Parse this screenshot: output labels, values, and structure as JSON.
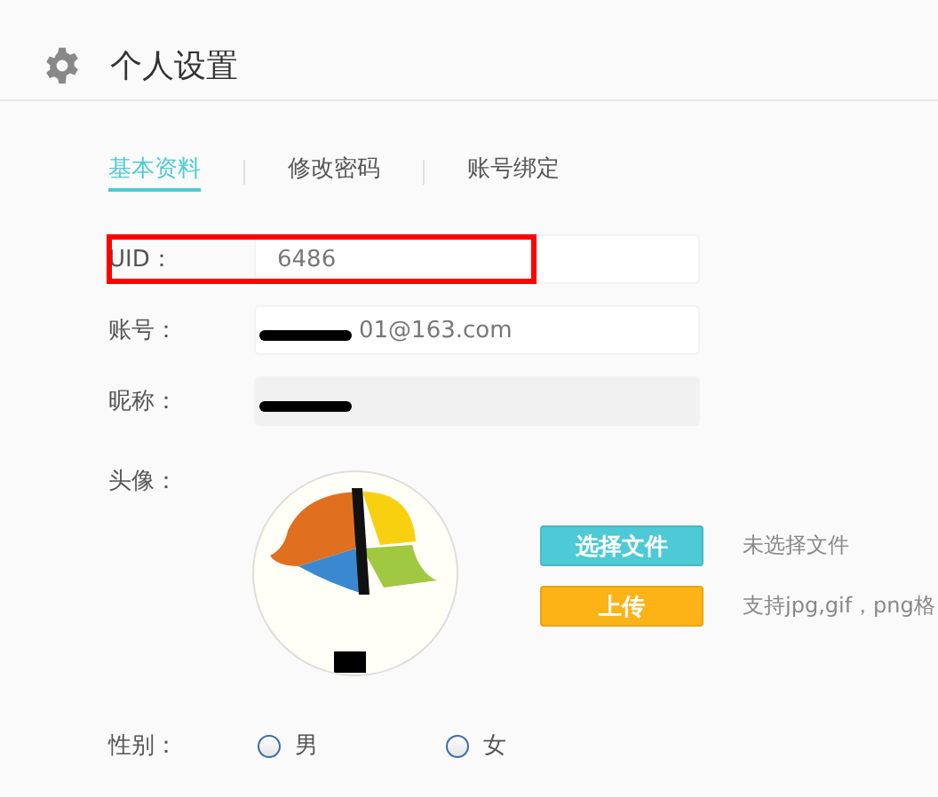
{
  "header": {
    "title": "个人设置"
  },
  "tabs": [
    {
      "label": "基本资料",
      "selected": true
    },
    {
      "label": "修改密码",
      "selected": false
    },
    {
      "label": "账号绑定",
      "selected": false
    }
  ],
  "fields": [
    {
      "label": "UID：",
      "value": "6486",
      "disabled": false,
      "redacted": false,
      "highlighted": true
    },
    {
      "label": "账号：",
      "value": "01@163.com",
      "disabled": false,
      "redacted": true,
      "highlighted": false
    },
    {
      "label": "昵称：",
      "disabled": true,
      "redacted": true,
      "highlighted": false
    }
  ],
  "avatar": {
    "label": "头像：",
    "choose_button": "选择文件",
    "file_status": "未选择文件",
    "upload_button": "上传",
    "hint": "支持jpg,gif，png格"
  },
  "gender": {
    "label": "性别：",
    "options": [
      {
        "label": "男",
        "selected": false
      },
      {
        "label": "女",
        "selected": false
      }
    ]
  }
}
